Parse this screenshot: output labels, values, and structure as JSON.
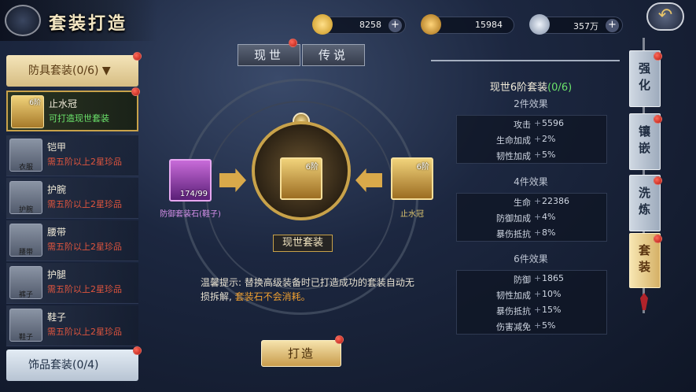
{
  "title": "套装打造",
  "currencies": [
    {
      "icon": "gold-ingot-icon",
      "value": "8258"
    },
    {
      "icon": "bound-gold-icon",
      "value": "15984"
    },
    {
      "icon": "silver-coin-icon",
      "value": "357万"
    }
  ],
  "left": {
    "armor_category": "防具套装(0/6)",
    "accessory_category": "饰品套装(0/4)",
    "items": [
      {
        "name": "止水冠",
        "desc": "可打造现世套装",
        "icon_text": "",
        "rank": "6阶",
        "selected": true
      },
      {
        "name": "铠甲",
        "desc": "需五阶以上2星珍品",
        "icon_text": "衣服"
      },
      {
        "name": "护腕",
        "desc": "需五阶以上2星珍品",
        "icon_text": "护腕"
      },
      {
        "name": "腰带",
        "desc": "需五阶以上2星珍品",
        "icon_text": "腰带"
      },
      {
        "name": "护腿",
        "desc": "需五阶以上2星珍品",
        "icon_text": "裤子"
      },
      {
        "name": "鞋子",
        "desc": "需五阶以上2星珍品",
        "icon_text": "鞋子"
      }
    ]
  },
  "tabs": [
    "现世",
    "传说"
  ],
  "center": {
    "left_slot": {
      "count": "174/99",
      "label": "防御套装石(鞋子)"
    },
    "center_slot": {
      "rank": "6阶"
    },
    "right_slot": {
      "rank": "6阶",
      "label": "止水冠"
    },
    "plate": "现世套装",
    "tip_prefix": "温馨提示:",
    "tip_body": "替换高级装备时已打造成功的套装自动无损拆解,",
    "tip_highlight": "套装石不会消耗。",
    "forge_button": "打造"
  },
  "right": {
    "set_title": "现世6阶套装",
    "set_progress": "(0/6)",
    "effects": [
      {
        "head": "2件效果",
        "stats": [
          [
            "攻击",
            "5596"
          ],
          [
            "生命加成",
            "2%"
          ],
          [
            "韧性加成",
            "5%"
          ]
        ]
      },
      {
        "head": "4件效果",
        "stats": [
          [
            "生命",
            "22386"
          ],
          [
            "防御加成",
            "4%"
          ],
          [
            "暴伤抵抗",
            "8%"
          ]
        ]
      },
      {
        "head": "6件效果",
        "stats": [
          [
            "防御",
            "1865"
          ],
          [
            "韧性加成",
            "10%"
          ],
          [
            "暴伤抵抗",
            "15%"
          ],
          [
            "伤害减免",
            "5%"
          ]
        ]
      }
    ],
    "vtabs": [
      "强化",
      "镶嵌",
      "洗炼",
      "套装"
    ]
  },
  "colors": {
    "gold": "#c8a24a",
    "red_text": "#e0553e",
    "green_text": "#6be36b",
    "orange_hl": "#f0a030"
  }
}
